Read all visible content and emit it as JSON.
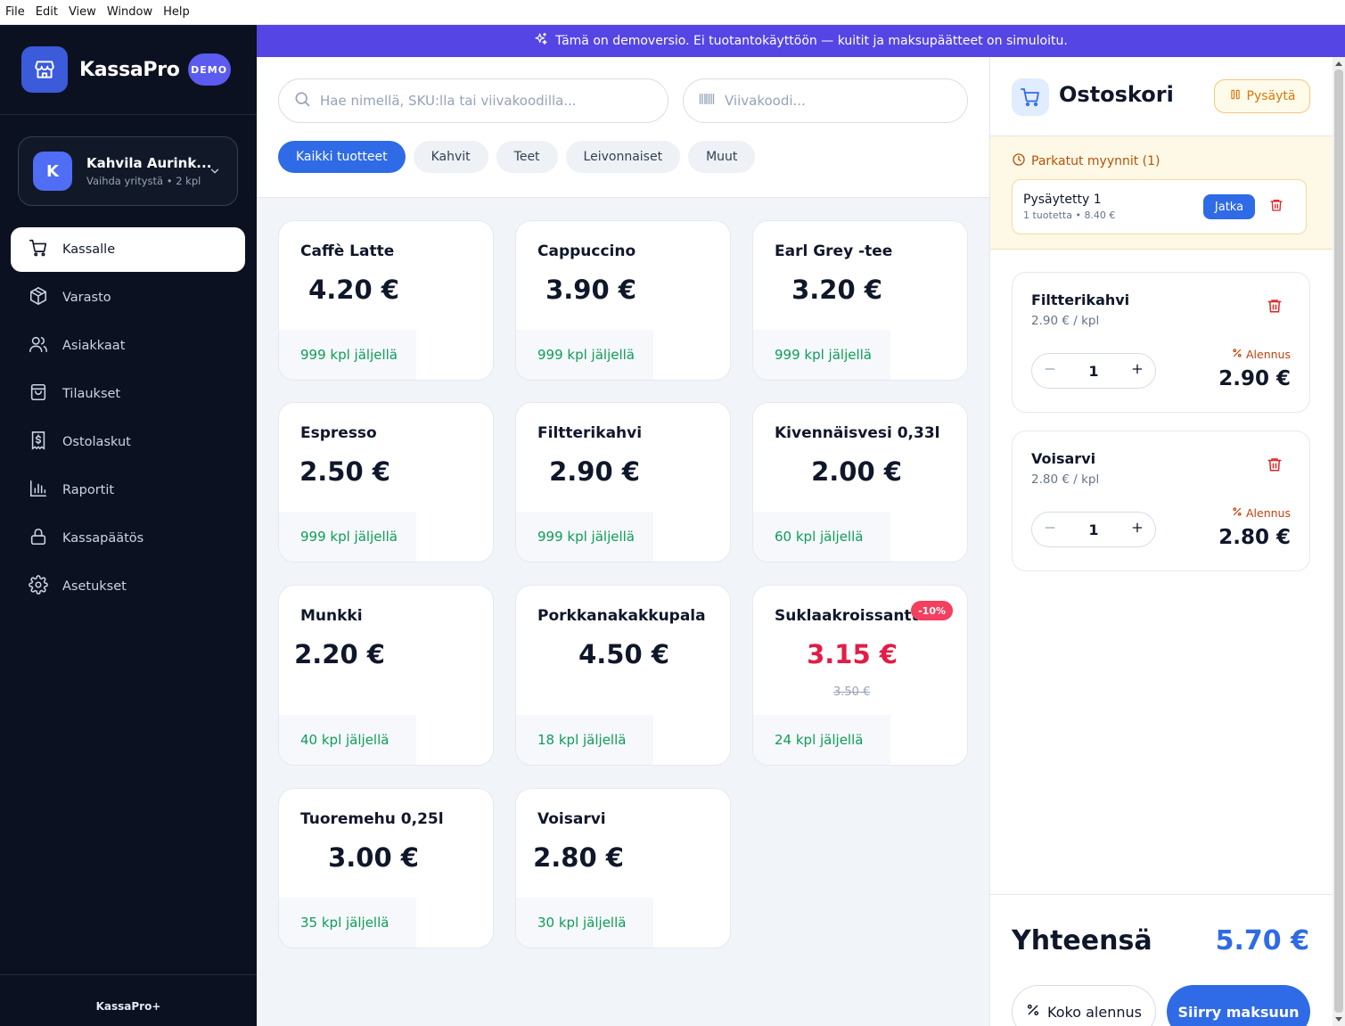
{
  "menubar": {
    "items": [
      "File",
      "Edit",
      "View",
      "Window",
      "Help"
    ]
  },
  "brand": {
    "name": "KassaPro",
    "badge": "DEMO",
    "icon": "store-icon"
  },
  "company": {
    "initial": "K",
    "name": "Kahvila Aurink...",
    "sub": "Vaihda yritystä • 2 kpl"
  },
  "nav": [
    {
      "label": "Kassalle",
      "icon": "cart-icon",
      "active": true
    },
    {
      "label": "Varasto",
      "icon": "box-icon"
    },
    {
      "label": "Asiakkaat",
      "icon": "users-icon"
    },
    {
      "label": "Tilaukset",
      "icon": "bag-icon"
    },
    {
      "label": "Ostolaskut",
      "icon": "invoice-icon"
    },
    {
      "label": "Raportit",
      "icon": "bar-chart-icon"
    },
    {
      "label": "Kassapäätös",
      "icon": "lock-icon"
    },
    {
      "label": "Asetukset",
      "icon": "gear-icon"
    }
  ],
  "sidebar_footer": "KassaPro+",
  "banner": {
    "text": "Tämä on demoversio. Ei tuotantokäyttöön — kuitit ja maksupäätteet on simuloitu."
  },
  "search": {
    "placeholder": "Hae nimellä, SKU:lla tai viivakoodilla...",
    "value": ""
  },
  "barcode": {
    "placeholder": "Viivakoodi...",
    "value": ""
  },
  "categories": [
    {
      "label": "Kaikki tuotteet",
      "active": true
    },
    {
      "label": "Kahvit"
    },
    {
      "label": "Teet"
    },
    {
      "label": "Leivonnaiset"
    },
    {
      "label": "Muut"
    }
  ],
  "products": [
    {
      "name": "Caffè Latte",
      "price": "4.20 €",
      "stock": "999 kpl jäljellä"
    },
    {
      "name": "Cappuccino",
      "price": "3.90 €",
      "stock": "999 kpl jäljellä"
    },
    {
      "name": "Earl Grey -tee",
      "price": "3.20 €",
      "stock": "999 kpl jäljellä"
    },
    {
      "name": "Espresso",
      "price": "2.50 €",
      "stock": "999 kpl jäljellä"
    },
    {
      "name": "Filtterikahvi",
      "price": "2.90 €",
      "stock": "999 kpl jäljellä"
    },
    {
      "name": "Kivennäisvesi 0,33l",
      "price": "2.00 €",
      "stock": "60 kpl jäljellä"
    },
    {
      "name": "Munkki",
      "price": "2.20 €",
      "stock": "40 kpl jäljellä"
    },
    {
      "name": "Porkkanakakkupala",
      "price": "4.50 €",
      "stock": "18 kpl jäljellä"
    },
    {
      "name": "Suklaakroissantti",
      "price": "3.15 €",
      "old_price": "3.50 €",
      "badge": "-10%",
      "stock": "24 kpl jäljellä"
    },
    {
      "name": "Tuoremehu 0,25l",
      "price": "3.00 €",
      "stock": "35 kpl jäljellä"
    },
    {
      "name": "Voisarvi",
      "price": "2.80 €",
      "stock": "30 kpl jäljellä"
    }
  ],
  "cart": {
    "title": "Ostoskori",
    "pause_label": "Pysäytä",
    "parked_title": "Parkatut myynnit (1)",
    "parked": {
      "name": "Pysäytetty 1",
      "sub": "1 tuotetta • 8.40 €",
      "resume_label": "Jatka"
    },
    "lines": [
      {
        "name": "Filtterikahvi",
        "unit": "2.90 € / kpl",
        "qty": "1",
        "discount_label": "Alennus",
        "total": "2.90 €"
      },
      {
        "name": "Voisarvi",
        "unit": "2.80 € / kpl",
        "qty": "1",
        "discount_label": "Alennus",
        "total": "2.80 €"
      }
    ],
    "total_label": "Yhteensä",
    "total_value": "5.70 €",
    "discount_all_label": "Koko alennus",
    "checkout_label": "Siirry maksuun"
  },
  "colors": {
    "accent": "#2f6be6",
    "sidebar": "#0b1120",
    "banner": "#5545e5",
    "stock": "#0f9d58",
    "sale": "#e11d48",
    "parked_bg": "#fef8e6"
  }
}
